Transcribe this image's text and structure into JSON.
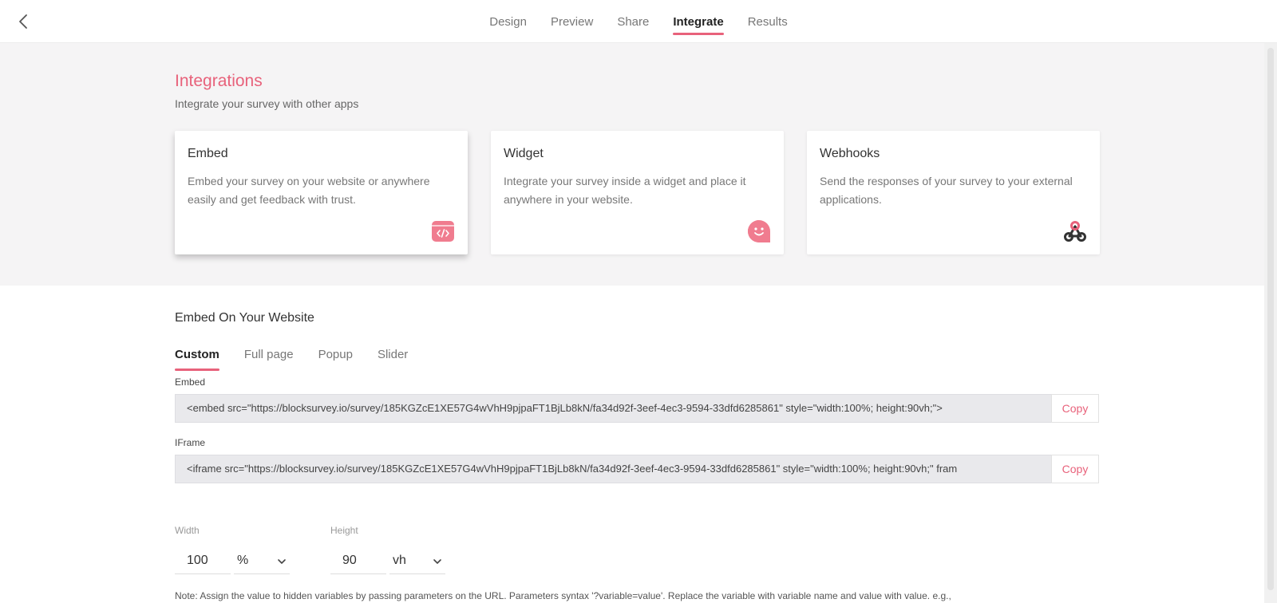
{
  "nav": {
    "tabs": [
      "Design",
      "Preview",
      "Share",
      "Integrate",
      "Results"
    ],
    "active": "Integrate"
  },
  "hero": {
    "title": "Integrations",
    "subtitle": "Integrate your survey with other apps"
  },
  "cards": [
    {
      "title": "Embed",
      "description": "Embed your survey on your website or anywhere easily and get feedback with trust.",
      "icon": "code-window-icon"
    },
    {
      "title": "Widget",
      "description": "Integrate your survey inside a widget and place it anywhere in your website.",
      "icon": "smiley-chat-icon"
    },
    {
      "title": "Webhooks",
      "description": "Send the responses of your survey to your external applications.",
      "icon": "webhook-icon"
    }
  ],
  "embed_section": {
    "title": "Embed On Your Website",
    "tabs": [
      "Custom",
      "Full page",
      "Popup",
      "Slider"
    ],
    "active_tab": "Custom",
    "embed_label": "Embed",
    "embed_code": "<embed src=\"https://blocksurvey.io/survey/185KGZcE1XE57G4wVhH9pjpaFT1BjLb8kN/fa34d92f-3eef-4ec3-9594-33dfd6285861\" style=\"width:100%; height:90vh;\">",
    "iframe_label": "IFrame",
    "iframe_code": "<iframe src=\"https://blocksurvey.io/survey/185KGZcE1XE57G4wVhH9pjpaFT1BjLb8kN/fa34d92f-3eef-4ec3-9594-33dfd6285861\" style=\"width:100%; height:90vh;\" fram",
    "copy_label": "Copy",
    "width_label": "Width",
    "width_value": "100",
    "width_unit": "%",
    "height_label": "Height",
    "height_value": "90",
    "height_unit": "vh",
    "note": "Note: Assign the value to hidden variables by passing parameters on the URL. Parameters syntax '?variable=value'. Replace the variable with variable name and value with value. e.g.,"
  },
  "colors": {
    "accent": "#e8627b",
    "hero_bg": "#f5f4f5"
  }
}
